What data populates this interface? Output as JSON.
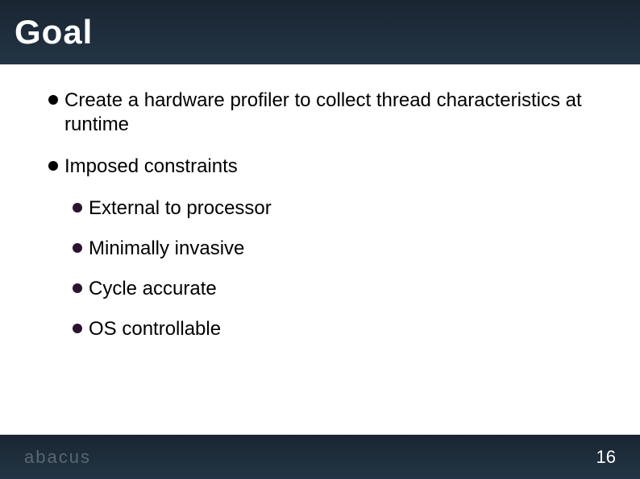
{
  "slide": {
    "title": "Goal",
    "bullets": [
      {
        "text": "Create a hardware profiler to collect thread characteristics at runtime",
        "level": 0
      },
      {
        "text": "Imposed constraints",
        "level": 0
      },
      {
        "text": "External to processor",
        "level": 1
      },
      {
        "text": "Minimally invasive",
        "level": 1
      },
      {
        "text": "Cycle accurate",
        "level": 1
      },
      {
        "text": "OS controllable",
        "level": 1
      }
    ]
  },
  "footer": {
    "logo": "abacus",
    "page_number": "16"
  }
}
